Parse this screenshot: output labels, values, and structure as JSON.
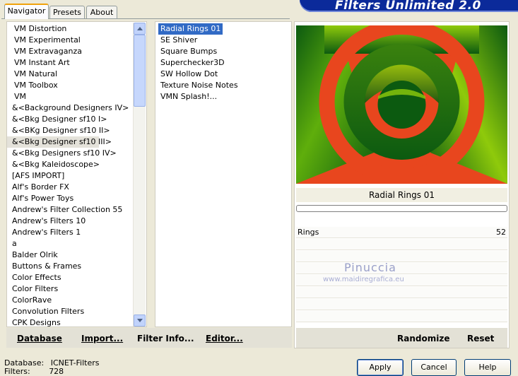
{
  "tabs": [
    {
      "label": "Navigator",
      "active": true
    },
    {
      "label": "Presets",
      "active": false
    },
    {
      "label": "About",
      "active": false
    }
  ],
  "banner_title": "Filters Unlimited 2.0",
  "categories": {
    "items": [
      "VM Distortion",
      "VM Experimental",
      "VM Extravaganza",
      "VM Instant Art",
      "VM Natural",
      "VM Toolbox",
      "VM",
      "&<Background Designers IV>",
      "&<Bkg Designer sf10 I>",
      "&<BKg Designer sf10 II>",
      "&<Bkg Designer sf10 III>",
      "&<Bkg Designers sf10 IV>",
      "&<Bkg Kaleidoscope>",
      "[AFS IMPORT]",
      "Alf's Border FX",
      "Alf's Power Toys",
      "Andrew's Filter Collection 55",
      "Andrew's Filters 10",
      "Andrew's Filters 1",
      "a",
      "Balder Olrik",
      "Buttons & Frames",
      "Color Effects",
      "Color Filters",
      "ColorRave",
      "Convolution Filters",
      "CPK Designs"
    ],
    "selected": "&<Bkg Designer sf10 III>"
  },
  "filters": {
    "items": [
      "Radial Rings 01",
      "SE Shiver",
      "Square Bumps",
      "Superchecker3D",
      "SW Hollow Dot",
      "Texture Noise Notes",
      "VMN Splash!..."
    ],
    "selected": "Radial Rings 01"
  },
  "toolbar": {
    "database": "Database",
    "import": "Import...",
    "filter_info": "Filter Info...",
    "editor": "Editor...",
    "randomize": "Randomize",
    "reset": "Reset"
  },
  "preview": {
    "filter_name": "Radial Rings 01",
    "colors": {
      "background": "#e8461e",
      "ring_dark": "#0c5a10",
      "ring_light": "#8fca0b"
    }
  },
  "sliders": [
    {
      "label": "Rings",
      "value": "52"
    }
  ],
  "watermark": {
    "name": "Pinuccia",
    "url": "www.maidiregrafica.eu"
  },
  "status": {
    "database_label": "Database:",
    "database_value": "ICNET-Filters",
    "filters_label": "Filters:",
    "filters_value": "728"
  },
  "buttons": {
    "apply": "Apply",
    "cancel": "Cancel",
    "help": "Help"
  }
}
